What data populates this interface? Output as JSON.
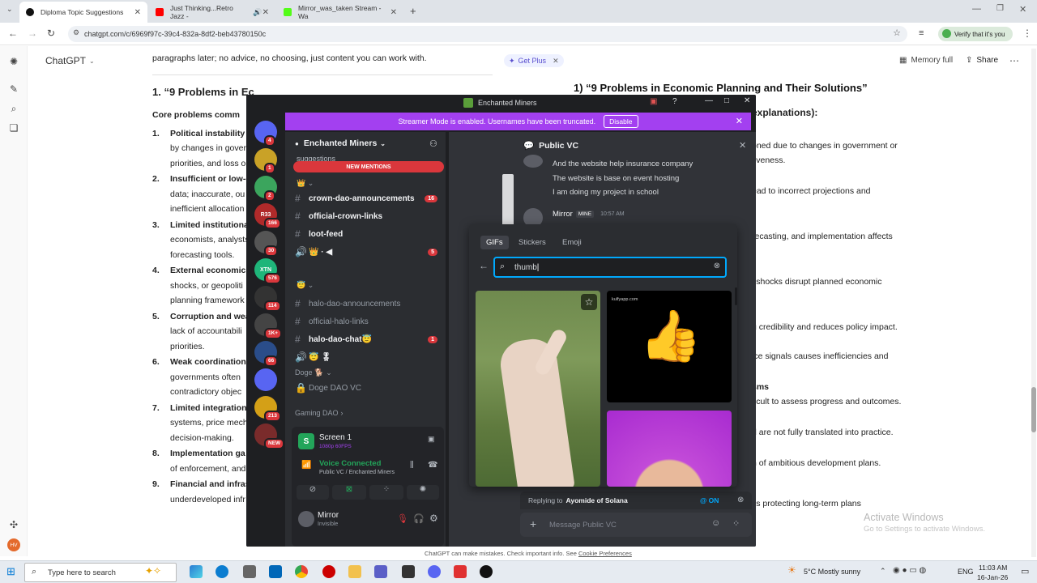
{
  "browser": {
    "tabs": [
      {
        "title": "Diploma Topic Suggestions",
        "icon": "chatgpt-icon"
      },
      {
        "title": "Just Thinking...Retro Jazz -",
        "icon": "youtube-icon"
      },
      {
        "title": "Mirror_was_taken Stream - Wa",
        "icon": "kick-icon"
      }
    ],
    "url": "chatgpt.com/c/6969f97c-39c4-832a-8df2-beb43780150c",
    "verify_label": "Verify that it's you"
  },
  "chatgpt": {
    "model": "ChatGPT",
    "get_plus": "Get Plus",
    "memory": "Memory full",
    "share": "Share",
    "intro": "paragraphs later; no advice, no choosing, just content you can work with.",
    "left_heading": "1. “9 Problems in Ec",
    "core": "Core problems comm",
    "items": [
      {
        "n": "1.",
        "title": "Political instability a",
        "lines": [
          "by changes in gover",
          "priorities, and loss o"
        ]
      },
      {
        "n": "2.",
        "title": "Insufficient or low-q",
        "lines": [
          "data; inaccurate, ou",
          "inefficient allocation"
        ]
      },
      {
        "n": "3.",
        "title": "Limited institutiona",
        "lines": [
          "economists, analysts",
          "forecasting tools."
        ]
      },
      {
        "n": "4.",
        "title": "External economic s",
        "lines": [
          "shocks, or geopoliti",
          "planning framework"
        ]
      },
      {
        "n": "5.",
        "title": "Corruption and wea",
        "lines": [
          "lack of accountabili",
          "priorities."
        ]
      },
      {
        "n": "6.",
        "title": "Weak coordination",
        "lines": [
          "governments often",
          "contradictory objec"
        ]
      },
      {
        "n": "7.",
        "title": "Limited integration",
        "lines": [
          "systems, price mech",
          "decision-making."
        ]
      },
      {
        "n": "8.",
        "title": "Implementation ga",
        "lines": [
          "of enforcement, and"
        ]
      },
      {
        "n": "9.",
        "title": "Financial and infras",
        "lines": [
          "underdeveloped infr"
        ]
      }
    ],
    "right_heading": "1) “9 Problems in Economic Planning and Their Solutions”",
    "right_sub": "explanations):",
    "right_lines": [
      "oned due to changes in government or",
      "tiveness.",
      "ead to incorrect projections and",
      "recasting, and implementation affects",
      "l shocks disrupt planned economic",
      "g credibility and reduces policy impact.",
      "ice signals causes inefficiencies and",
      "sms",
      "ficult to assess progress and outcomes.",
      "d are not fully translated into practice.",
      "n of ambitious development plans.",
      "ks protecting long-term plans"
    ],
    "footer": "ChatGPT can make mistakes. Check important info. See",
    "footer_link": "Cookie Preferences",
    "activate_title": "Activate Windows",
    "activate_sub": "Go to Settings to activate Windows."
  },
  "discord": {
    "window_title": "Enchanted Miners",
    "streamer_msg": "Streamer Mode is enabled. Usernames have been truncated.",
    "disable": "Disable",
    "server_name": "Enchanted Miners",
    "suggestions": "suggestions",
    "new_mentions": "NEW MENTIONS",
    "channels": [
      {
        "name": "crown-dao-announcements",
        "count": "16",
        "dim": false
      },
      {
        "name": "official-crown-links",
        "count": "",
        "dim": false
      },
      {
        "name": "loot-feed",
        "count": "",
        "dim": false
      },
      {
        "name": "👑 · ◀",
        "count": "5",
        "dim": false
      },
      {
        "name": "halo-dao-announcements",
        "count": "",
        "dim": true
      },
      {
        "name": "official-halo-links",
        "count": "",
        "dim": true
      },
      {
        "name": "halo-dao-chat😇",
        "count": "1",
        "dim": false
      },
      {
        "name": "😇 🎖",
        "count": "",
        "dim": false
      }
    ],
    "category_doge": "Doge 🐕",
    "doge_vc": "Doge DAO VC",
    "category_gaming": "Gaming DAO",
    "screen": "Screen 1",
    "screen_sub": "1080p 60FPS",
    "voice": "Voice Connected",
    "voice_sub": "Public VC / Enchanted Miners",
    "user": "Mirror",
    "user_status": "Invisible",
    "vc_title": "Public VC",
    "messages": [
      "And the website help insurance company",
      "The website is base on event hosting",
      "I am doing my project in school"
    ],
    "msg_author": "Mirror",
    "msg_tag": "MINE",
    "msg_time": "10:57 AM",
    "gif_tabs": [
      "GIFs",
      "Stickers",
      "Emoji"
    ],
    "search_value": "thumb",
    "gif_watermark": "kulfyapp.com",
    "replying_prefix": "Replying to",
    "replying_to": "Ayomide of Solana",
    "ping": "@ ON",
    "message_placeholder": "Message Public VC",
    "servers": [
      {
        "label": "",
        "badge": "4",
        "color": "#5865f2"
      },
      {
        "label": "",
        "badge": "1",
        "color": "#c9a227"
      },
      {
        "label": "",
        "badge": "2",
        "color": "#3ba55d"
      },
      {
        "label": "R33",
        "badge": "166",
        "color": "#b02a2a"
      },
      {
        "label": "",
        "badge": "30",
        "color": "#555"
      },
      {
        "label": "XTN",
        "badge": "576",
        "color": "#1fb57a"
      },
      {
        "label": "",
        "badge": "114",
        "color": "#333"
      },
      {
        "label": "",
        "badge": "1K+",
        "color": "#444"
      },
      {
        "label": "",
        "badge": "66",
        "color": "#2a4d8a"
      },
      {
        "label": "",
        "badge": "",
        "color": "#5865f2"
      },
      {
        "label": "",
        "badge": "213",
        "color": "#d4a017"
      },
      {
        "label": "",
        "badge": "NEW",
        "color": "#7a2b2b"
      }
    ]
  },
  "taskbar": {
    "search_placeholder": "Type here to search",
    "weather": "5°C  Mostly sunny",
    "lang": "ENG",
    "time": "11:03 AM",
    "date": "16-Jan-26"
  }
}
